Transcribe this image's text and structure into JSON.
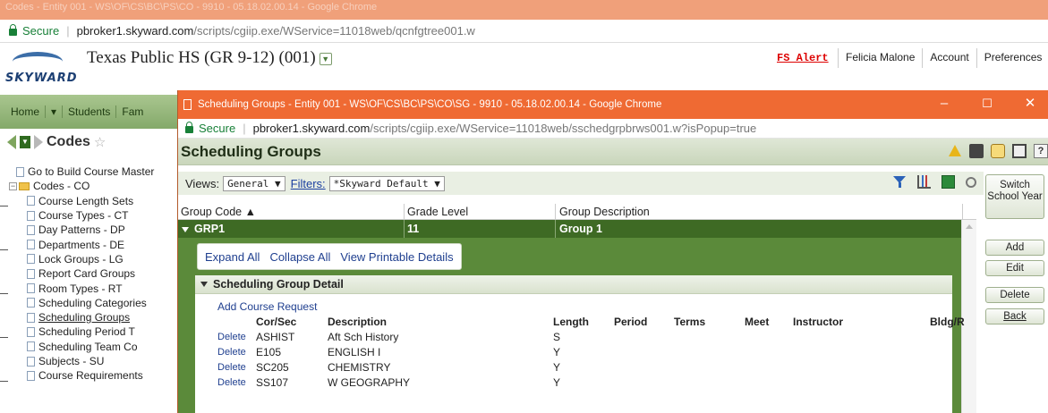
{
  "back_window": {
    "title_bar": "Codes - Entity 001 - WS\\OF\\CS\\BC\\PS\\CO - 9910 - 05.18.02.00.14 - Google Chrome",
    "address": {
      "secure": "Secure",
      "host": "pbroker1.skyward.com",
      "path": "/scripts/cgiip.exe/WService=11018web/qcnfgtree001.w"
    },
    "logo_text": "SKYWARD",
    "entity_title": "Texas Public HS (GR 9-12) (001)",
    "fs_alert": "FS Alert",
    "user_links": [
      "Felicia Malone",
      "Account",
      "Preferences"
    ],
    "nav": [
      "Home",
      "Students",
      "Fam"
    ],
    "codes_title": "Codes",
    "tree": [
      {
        "label": "Go to Build Course Master",
        "icon": "doc",
        "indent": 1
      },
      {
        "label": "Codes - CO",
        "icon": "folder",
        "indent": 0
      },
      {
        "label": "Course Length Sets",
        "icon": "doc",
        "indent": 2
      },
      {
        "label": "Course Types - CT",
        "icon": "doc",
        "indent": 2
      },
      {
        "label": "Day Patterns - DP",
        "icon": "doc",
        "indent": 2
      },
      {
        "label": "Departments - DE",
        "icon": "doc",
        "indent": 2
      },
      {
        "label": "Lock Groups - LG",
        "icon": "doc",
        "indent": 2
      },
      {
        "label": "Report Card Groups",
        "icon": "doc",
        "indent": 2
      },
      {
        "label": "Room Types - RT",
        "icon": "doc",
        "indent": 2
      },
      {
        "label": "Scheduling Categories",
        "icon": "doc",
        "indent": 2
      },
      {
        "label": "Scheduling Groups",
        "icon": "doc",
        "indent": 2,
        "underlined": true
      },
      {
        "label": "Scheduling Period T",
        "icon": "doc",
        "indent": 2
      },
      {
        "label": "Scheduling Team Co",
        "icon": "doc",
        "indent": 2
      },
      {
        "label": "Subjects - SU",
        "icon": "doc",
        "indent": 2
      },
      {
        "label": "Course Requirements",
        "icon": "doc",
        "indent": 2
      }
    ]
  },
  "popup": {
    "title": "Scheduling Groups - Entity 001 - WS\\OF\\CS\\BC\\PS\\CO\\SG - 9910 - 05.18.02.00.14 - Google Chrome",
    "window_controls": {
      "minimize": "–",
      "maximize": "☐",
      "close": "✕"
    },
    "address": {
      "secure": "Secure",
      "host": "pbroker1.skyward.com",
      "path": "/scripts/cgiip.exe/WService=11018web/sschedgrpbrws001.w?isPopup=true"
    },
    "page_title": "Scheduling Groups",
    "help_label": "?",
    "views_label": "Views:",
    "views_value": "General",
    "filters_label": "Filters:",
    "filters_value": "*Skyward Default",
    "columns": [
      "Group Code ▲",
      "Grade Level",
      "Group Description"
    ],
    "selected_row": {
      "group_code": "GRP1",
      "grade_level": "11",
      "description": "Group 1"
    },
    "expand_links": [
      "Expand All",
      "Collapse All",
      "View Printable Details"
    ],
    "detail_title": "Scheduling Group Detail",
    "add_course_request": "Add Course Request",
    "course_columns": [
      "Cor/Sec",
      "Description",
      "Length",
      "Period",
      "Terms",
      "Meet",
      "Instructor",
      "Bldg/R"
    ],
    "courses": [
      {
        "action": "Delete",
        "cor_sec": "ASHIST",
        "description": "Aft Sch History",
        "length": "S"
      },
      {
        "action": "Delete",
        "cor_sec": "E105",
        "description": "ENGLISH I",
        "length": "Y"
      },
      {
        "action": "Delete",
        "cor_sec": "SC205",
        "description": "CHEMISTRY",
        "length": "Y"
      },
      {
        "action": "Delete",
        "cor_sec": "SS107",
        "description": "W GEOGRAPHY",
        "length": "Y"
      }
    ],
    "side_buttons": {
      "switch_school_year": "Switch School Year",
      "add": "Add",
      "edit": "Edit",
      "delete": "Delete",
      "back": "Back"
    }
  },
  "colors": {
    "popup_titlebar": "#ef6a33",
    "selected_row": "#3e6a24",
    "expanded_bg": "#5b8a3a",
    "link_blue": "#1f3f8f",
    "alert_red": "#dd0000"
  }
}
